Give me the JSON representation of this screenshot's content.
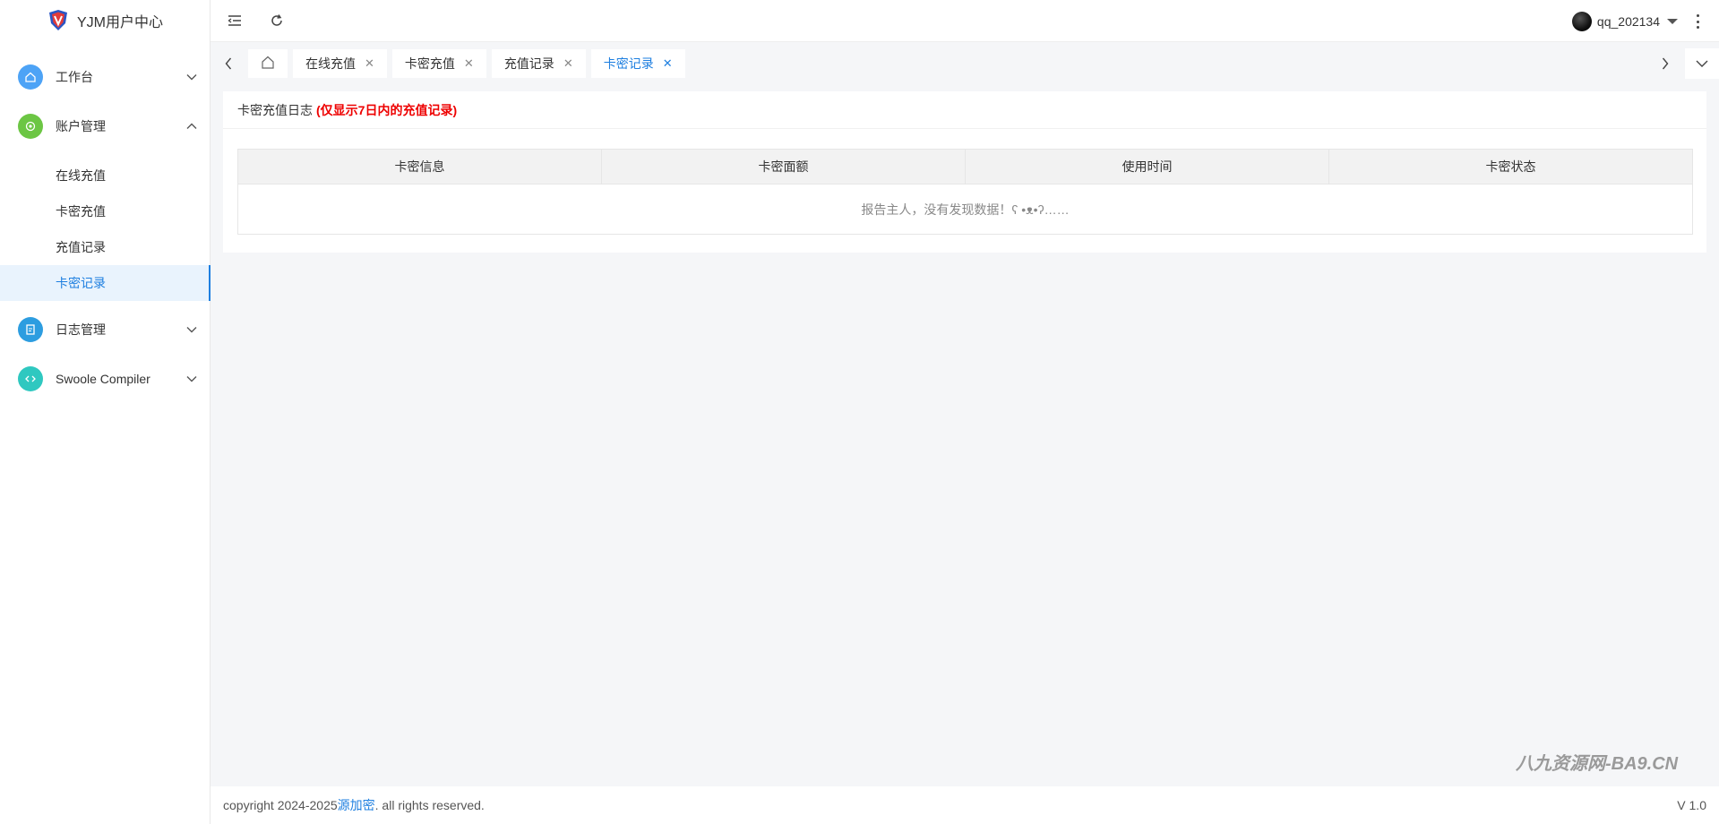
{
  "app": {
    "title": "YJM用户中心"
  },
  "sidebar": {
    "items": [
      {
        "label": "工作台",
        "icon": "home-icon",
        "color": "#4da3f6",
        "expanded": false
      },
      {
        "label": "账户管理",
        "icon": "account-icon",
        "color": "#6cc644",
        "expanded": true,
        "children": [
          {
            "label": "在线充值"
          },
          {
            "label": "卡密充值"
          },
          {
            "label": "充值记录"
          },
          {
            "label": "卡密记录",
            "active": true
          }
        ]
      },
      {
        "label": "日志管理",
        "icon": "log-icon",
        "color": "#2d9de0",
        "expanded": false
      },
      {
        "label": "Swoole Compiler",
        "icon": "code-icon",
        "color": "#2fc8c0",
        "expanded": false
      }
    ]
  },
  "header": {
    "username": "qq_202134"
  },
  "tabs": [
    {
      "label": "在线充值",
      "close": "✕"
    },
    {
      "label": "卡密充值",
      "close": "✕"
    },
    {
      "label": "充值记录",
      "close": "✕"
    },
    {
      "label": "卡密记录",
      "close": "✕",
      "active": true
    }
  ],
  "card": {
    "title": "卡密充值日志",
    "note": "(仅显示7日内的充值记录)"
  },
  "table": {
    "columns": [
      "卡密信息",
      "卡密面额",
      "使用时间",
      "卡密状态"
    ],
    "empty_text": "报告主人，没有发现数据！ʕ •ᴥ•ʔ……"
  },
  "footer": {
    "prefix": "copyright 2024-2025 ",
    "link": "源加密",
    "suffix": ". all rights reserved.",
    "version": "V 1.0"
  },
  "watermark": "八九资源网-BA9.CN",
  "colors": {
    "accent": "#1e7fe0",
    "note": "#ee0000"
  }
}
